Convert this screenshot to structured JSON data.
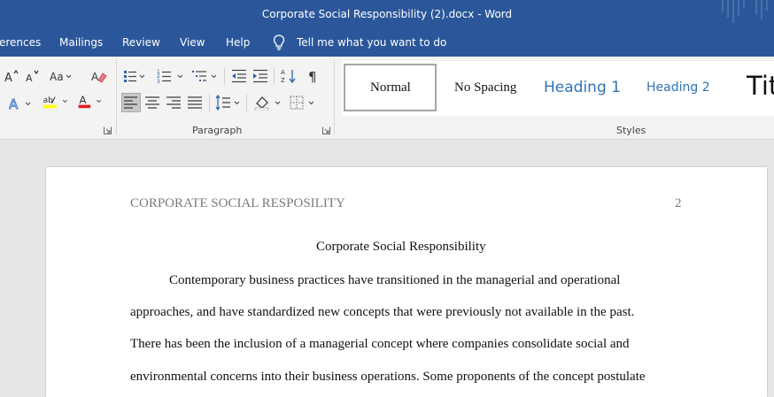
{
  "window": {
    "title": "Corporate Social Responsibility (2).docx  -  Word",
    "title_bar_color": "#2b579a"
  },
  "tabs": {
    "references": "erences",
    "mailings": "Mailings",
    "review": "Review",
    "view": "View",
    "help": "Help",
    "tell_me": "Tell me what you want to do"
  },
  "ribbon": {
    "paragraph_label": "Paragraph",
    "styles_label": "Styles",
    "styles": {
      "normal": "Normal",
      "no_spacing": "No Spacing",
      "heading1": "Heading 1",
      "heading2": "Heading 2",
      "title": "Tit"
    },
    "heading_color": "#2e74b5",
    "icons": [
      "font-size-up-icon",
      "font-size-down-icon",
      "change-case-icon",
      "clear-formatting-icon",
      "text-effects-icon",
      "highlight-icon",
      "font-color-icon",
      "bullets-icon",
      "numbering-icon",
      "multilevel-list-icon",
      "decrease-indent-icon",
      "increase-indent-icon",
      "sort-icon",
      "show-marks-icon",
      "align-left-icon",
      "align-center-icon",
      "align-right-icon",
      "justify-icon",
      "line-spacing-icon",
      "shading-icon",
      "borders-icon"
    ]
  },
  "document": {
    "running_head": "CORPORATE SOCIAL RESPOSILITY",
    "page_number": "2",
    "heading": "Corporate Social Responsibility",
    "lines": [
      "Contemporary business practices have transitioned in the managerial and operational",
      "approaches, and have standardized new concepts that were previously not available in the past.",
      "There has been the inclusion of a managerial concept where companies consolidate social and",
      "environmental concerns into their business operations. Some proponents of the concept postulate"
    ]
  }
}
